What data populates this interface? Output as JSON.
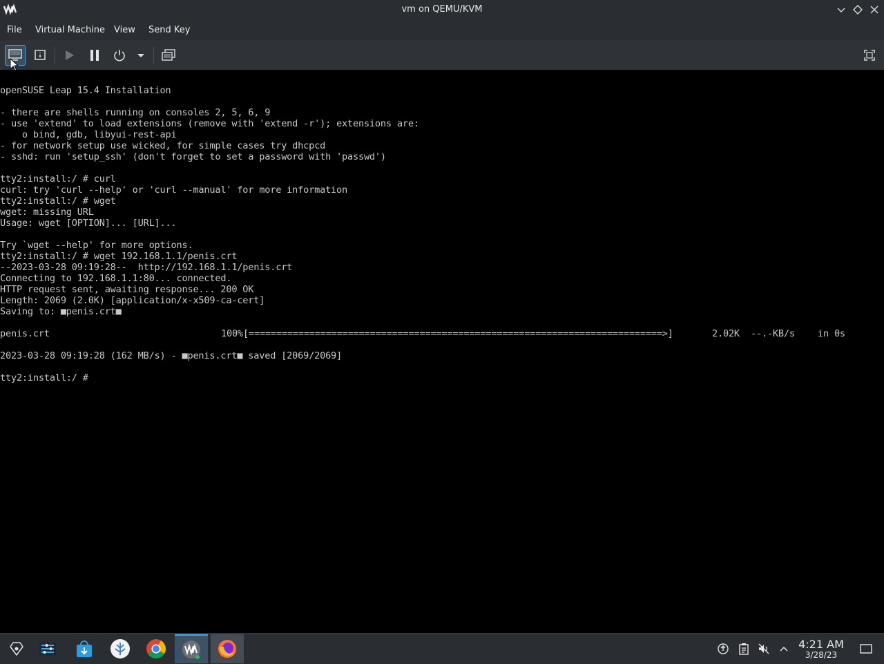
{
  "window": {
    "title": "vm on QEMU/KVM",
    "icons": [
      "vm-logo-icon",
      "minimize-icon",
      "maximize-icon",
      "close-icon"
    ]
  },
  "menu": {
    "items": [
      "File",
      "Virtual Machine",
      "View",
      "Send Key"
    ]
  },
  "toolbar": {
    "buttons": [
      "console-view-icon",
      "details-view-icon",
      "run-icon",
      "pause-icon",
      "power-icon",
      "power-menu-chevron-icon",
      "snapshots-icon",
      "fullscreen-icon"
    ]
  },
  "console": {
    "lines": [
      "openSUSE Leap 15.4 Installation",
      "",
      "- there are shells running on consoles 2, 5, 6, 9",
      "- use 'extend' to load extensions (remove with 'extend -r'); extensions are:",
      "    o bind, gdb, libyui-rest-api",
      "- for network setup use wicked, for simple cases try dhcpcd",
      "- sshd: run 'setup_ssh' (don't forget to set a password with 'passwd')",
      "",
      "tty2:install:/ # curl",
      "curl: try 'curl --help' or 'curl --manual' for more information",
      "tty2:install:/ # wget",
      "wget: missing URL",
      "Usage: wget [OPTION]... [URL]...",
      "",
      "Try `wget --help' for more options.",
      "tty2:install:/ # wget 192.168.1.1/penis.crt",
      "--2023-03-28 09:19:28--  http://192.168.1.1/penis.crt",
      "Connecting to 192.168.1.1:80... connected.",
      "HTTP request sent, awaiting response... 200 OK",
      "Length: 2069 (2.0K) [application/x-x509-ca-cert]",
      "Saving to: ■penis.crt■",
      "",
      "",
      "",
      "2023-03-28 09:19:28 (162 MB/s) - ■penis.crt■ saved [2069/2069]",
      "",
      "tty2:install:/ # "
    ],
    "progress": {
      "filename": "penis.crt",
      "percent_label": "100%",
      "bar": "[===========================================================================>]",
      "size": "2.02K",
      "rate": "--.-KB/s",
      "eta": "in 0s",
      "percent": 100
    }
  },
  "taskbar": {
    "apps": [
      "app-launcher-icon",
      "task-manager-icon",
      "discover-store-icon",
      "vm-manager-icon",
      "chrome-icon",
      "virt-manager-window-icon",
      "firefox-icon"
    ],
    "tray": [
      "network-updates-icon",
      "clipboard-icon",
      "volume-muted-icon",
      "tray-expand-icon",
      "show-desktop-icon"
    ],
    "time": "4:21 AM",
    "date": "3/28/23"
  }
}
